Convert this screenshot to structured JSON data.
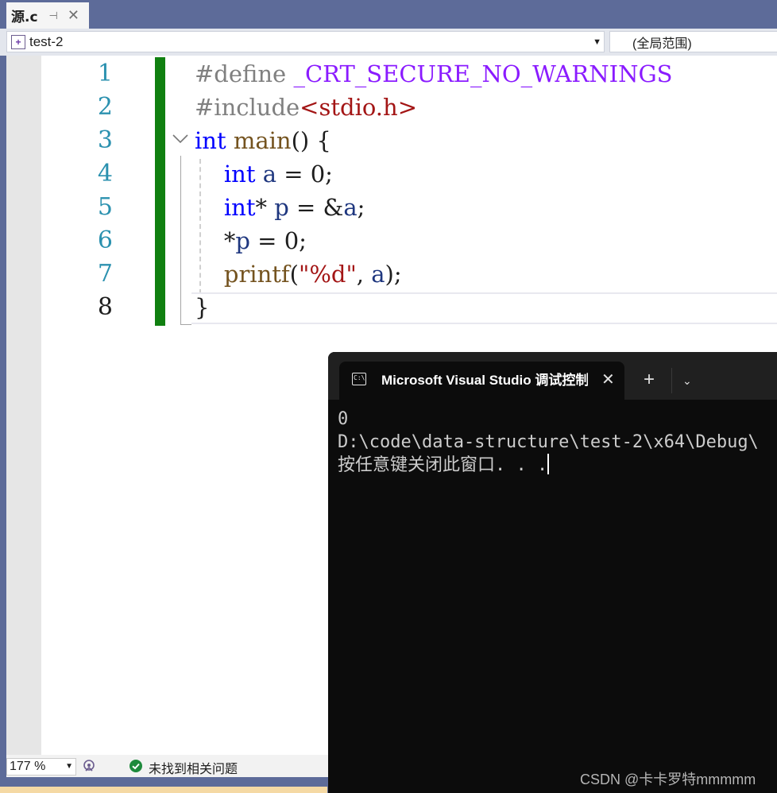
{
  "tab": {
    "title": "源.c",
    "pin_icon": "pin-icon",
    "close_icon": "close-icon"
  },
  "navbar": {
    "project": "test-2",
    "scope": "(全局范围)"
  },
  "editor": {
    "line_numbers": [
      "1",
      "2",
      "3",
      "4",
      "5",
      "6",
      "7",
      "8"
    ],
    "current_line": "8",
    "code": [
      [
        {
          "t": "#define ",
          "c": "pp"
        },
        {
          "t": "_CRT_SECURE_NO_WARNINGS",
          "c": "mac"
        }
      ],
      [
        {
          "t": "#include",
          "c": "pp"
        },
        {
          "t": "<stdio.h>",
          "c": "str"
        }
      ],
      [
        {
          "t": "int",
          "c": "kw"
        },
        {
          "t": " "
        },
        {
          "t": "main",
          "c": "fn"
        },
        {
          "t": "() {"
        }
      ],
      [
        {
          "t": "    "
        },
        {
          "t": "int",
          "c": "kw"
        },
        {
          "t": " "
        },
        {
          "t": "a",
          "c": "var"
        },
        {
          "t": " = 0;"
        }
      ],
      [
        {
          "t": "    "
        },
        {
          "t": "int",
          "c": "kw"
        },
        {
          "t": "* "
        },
        {
          "t": "p",
          "c": "var"
        },
        {
          "t": " = &"
        },
        {
          "t": "a",
          "c": "var"
        },
        {
          "t": ";"
        }
      ],
      [
        {
          "t": "    *"
        },
        {
          "t": "p",
          "c": "var"
        },
        {
          "t": " = 0;"
        }
      ],
      [
        {
          "t": "    "
        },
        {
          "t": "printf",
          "c": "fn"
        },
        {
          "t": "("
        },
        {
          "t": "\"%d\"",
          "c": "str"
        },
        {
          "t": ", "
        },
        {
          "t": "a",
          "c": "var"
        },
        {
          "t": ");"
        }
      ],
      [
        {
          "t": "}"
        }
      ]
    ]
  },
  "statusbar": {
    "zoom": "177 %",
    "issues": "未找到相关问题"
  },
  "console": {
    "tab_title": "Microsoft Visual Studio 调试控制台",
    "icon_text": "C:\\",
    "new_tab": "+",
    "close": "✕",
    "dropdown": "⌄",
    "output": [
      "0",
      "D:\\code\\data-structure\\test-2\\x64\\Debug\\",
      "按任意键关闭此窗口. . ."
    ]
  },
  "watermark": "CSDN @卡卡罗特mmmmm",
  "colors": {
    "chrome": "#5d6b99",
    "keyword": "#0000ff",
    "string": "#a31515",
    "function": "#74531f",
    "variable": "#1f377f",
    "preprocessor": "#808080",
    "macro": "#8a1bff",
    "line_number": "#2b91af",
    "change_bar": "#108010",
    "console_bg": "#0c0c0c"
  }
}
